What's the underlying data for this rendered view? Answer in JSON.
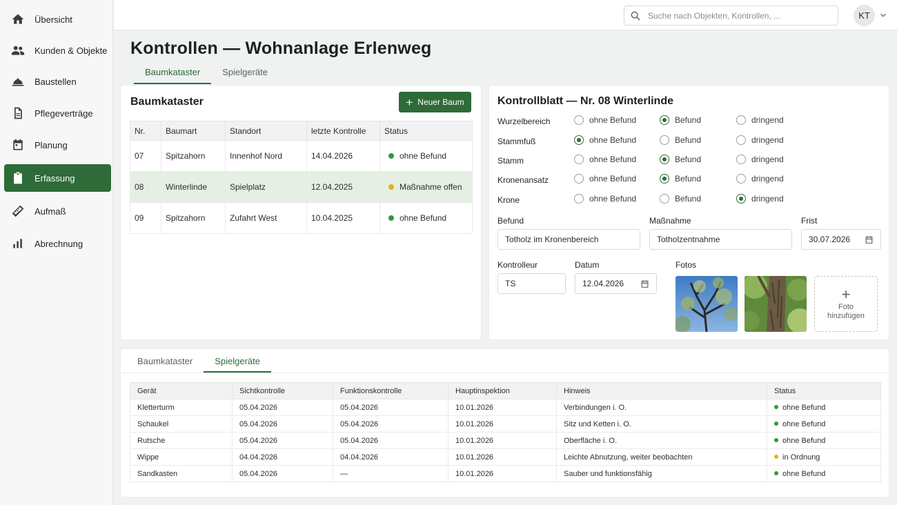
{
  "nav": {
    "items": [
      {
        "label": "Übersicht",
        "icon": "home-icon"
      },
      {
        "label": "Kunden & Objekte",
        "icon": "people-icon"
      },
      {
        "label": "Baustellen",
        "icon": "construction-icon"
      },
      {
        "label": "Pflegeverträge",
        "icon": "document-icon"
      },
      {
        "label": "Planung",
        "icon": "calendar-icon"
      },
      {
        "label": "Erfassung",
        "icon": "clipboard-icon",
        "active": true
      },
      {
        "label": "Aufmaß",
        "icon": "ruler-icon"
      },
      {
        "label": "Abrechnung",
        "icon": "bar-chart-icon"
      }
    ]
  },
  "topbar": {
    "search_placeholder": "Suche nach Objekten, Kontrollen, ...",
    "user_initials": "KT"
  },
  "page": {
    "title": "Kontrollen — Wohnanlage Erlenweg",
    "tabs": [
      {
        "label": "Baumkataster",
        "active": true
      },
      {
        "label": "Spielgeräte",
        "active": false
      }
    ]
  },
  "baumkataster": {
    "title": "Baumkataster",
    "new_button": "Neuer Baum",
    "columns": [
      "Nr.",
      "Baumart",
      "Standort",
      "letzte Kontrolle",
      "Status"
    ],
    "rows": [
      {
        "nr": "07",
        "baumart": "Spitzahorn",
        "standort": "Innenhof Nord",
        "kontrolle": "14.04.2026",
        "status": "ohne Befund",
        "status_color": "#2e9b3a"
      },
      {
        "nr": "08",
        "baumart": "Winterlinde",
        "standort": "Spielplatz",
        "kontrolle": "12.04.2025",
        "status": "Maßnahme offen",
        "status_color": "#e5b01f"
      },
      {
        "nr": "09",
        "baumart": "Spitzahorn",
        "standort": "Zufahrt West",
        "kontrolle": "10.04.2025",
        "status": "ohne Befund",
        "status_color": "#2e9b3a"
      }
    ]
  },
  "kontrollblatt": {
    "title": "Kontrollblatt — Nr. 08 Winterlinde",
    "options": [
      "ohne Befund",
      "Befund",
      "dringend"
    ],
    "criteria": [
      {
        "label": "Wurzelbereich",
        "selected": 1
      },
      {
        "label": "Stammfuß",
        "selected": 0
      },
      {
        "label": "Stamm",
        "selected": 1
      },
      {
        "label": "Kronenansatz",
        "selected": 1
      },
      {
        "label": "Krone",
        "selected": 2
      }
    ],
    "befund_label": "Befund",
    "befund_value": "Totholz im Kronenbereich",
    "massnahme_label": "Maßnahme",
    "massnahme_value": "Totholzentnahme",
    "frist_label": "Frist",
    "frist_value": "30.07.2026",
    "kontrolleur_label": "Kontrolleur",
    "kontrolleur_value": "TS",
    "datum_label": "Datum",
    "datum_value": "12.04.2026",
    "fotos_label": "Fotos",
    "add_photo_line1": "Foto",
    "add_photo_line2": "hinzufügen"
  },
  "spielgeraete": {
    "tabs": [
      {
        "label": "Baumkataster",
        "active": false
      },
      {
        "label": "Spielgeräte",
        "active": true
      }
    ],
    "columns": [
      "Gerät",
      "Sichtkontrolle",
      "Funktionskontrolle",
      "Hauptinspektion",
      "Hinweis",
      "Status"
    ],
    "rows": [
      {
        "geraet": "Kletterturm",
        "sicht": "05.04.2026",
        "funktion": "05.04.2026",
        "haupt": "10.01.2026",
        "hinweis": "Verbindungen i. O.",
        "status": "ohne Befund",
        "status_color": "#2e9b3a"
      },
      {
        "geraet": "Schaukel",
        "sicht": "05.04.2026",
        "funktion": "05.04.2026",
        "haupt": "10.01.2026",
        "hinweis": "Sitz und Ketten i. O.",
        "status": "ohne Befund",
        "status_color": "#2e9b3a"
      },
      {
        "geraet": "Rutsche",
        "sicht": "05.04.2026",
        "funktion": "05.04.2026",
        "haupt": "10.01.2026",
        "hinweis": "Oberfläche i. O.",
        "status": "ohne Befund",
        "status_color": "#2e9b3a"
      },
      {
        "geraet": "Wippe",
        "sicht": "04.04.2026",
        "funktion": "04.04.2026",
        "haupt": "10.01.2026",
        "hinweis": "Leichte Abnutzung, weiter beobachten",
        "status": "in Ordnung",
        "status_color": "#e5b01f"
      },
      {
        "geraet": "Sandkasten",
        "sicht": "05.04.2026",
        "funktion": "—",
        "haupt": "10.01.2026",
        "hinweis": "Sauber und funktionsfähig",
        "status": "ohne Befund",
        "status_color": "#2e9b3a"
      }
    ]
  },
  "colors": {
    "accent": "#2e6b38",
    "ok": "#2e9b3a",
    "warn": "#e5b01f"
  }
}
